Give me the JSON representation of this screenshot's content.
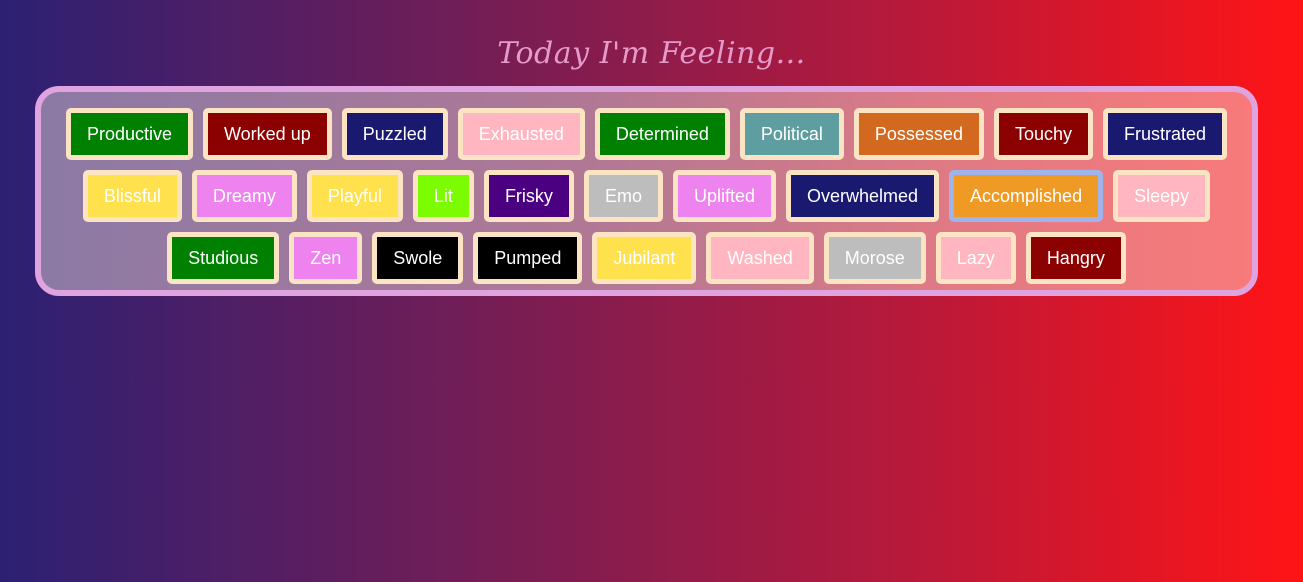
{
  "title": "Today I'm Feeling...",
  "rows": [
    [
      {
        "label": "Productive",
        "color": "#008000"
      },
      {
        "label": "Worked up",
        "color": "#8b0000"
      },
      {
        "label": "Puzzled",
        "color": "#191970"
      },
      {
        "label": "Exhausted",
        "color": "#ffb6c1"
      },
      {
        "label": "Determined",
        "color": "#008000"
      },
      {
        "label": "Political",
        "color": "#5f9ea0"
      },
      {
        "label": "Possessed",
        "color": "#d2691e"
      },
      {
        "label": "Touchy",
        "color": "#8b0000"
      },
      {
        "label": "Frustrated",
        "color": "#191970"
      }
    ],
    [
      {
        "label": "Blissful",
        "color": "#ffe14d"
      },
      {
        "label": "Dreamy",
        "color": "#ee82ee"
      },
      {
        "label": "Playful",
        "color": "#ffe14d"
      },
      {
        "label": "Lit",
        "color": "#7cfc00"
      },
      {
        "label": "Frisky",
        "color": "#4b0082"
      },
      {
        "label": "Emo",
        "color": "#bdbdbd"
      },
      {
        "label": "Uplifted",
        "color": "#ee82ee"
      },
      {
        "label": "Overwhelmed",
        "color": "#191970"
      },
      {
        "label": "Accomplished",
        "color": "#f09a26",
        "selected": true
      },
      {
        "label": "Sleepy",
        "color": "#ffb6c1"
      }
    ],
    [
      {
        "label": "Studious",
        "color": "#008000"
      },
      {
        "label": "Zen",
        "color": "#ee82ee"
      },
      {
        "label": "Swole",
        "color": "#000000"
      },
      {
        "label": "Pumped",
        "color": "#000000"
      },
      {
        "label": "Jubilant",
        "color": "#ffe14d"
      },
      {
        "label": "Washed",
        "color": "#ffb6c1"
      },
      {
        "label": "Morose",
        "color": "#bdbdbd"
      },
      {
        "label": "Lazy",
        "color": "#ffb6c1"
      },
      {
        "label": "Hangry",
        "color": "#8b0000"
      }
    ]
  ]
}
